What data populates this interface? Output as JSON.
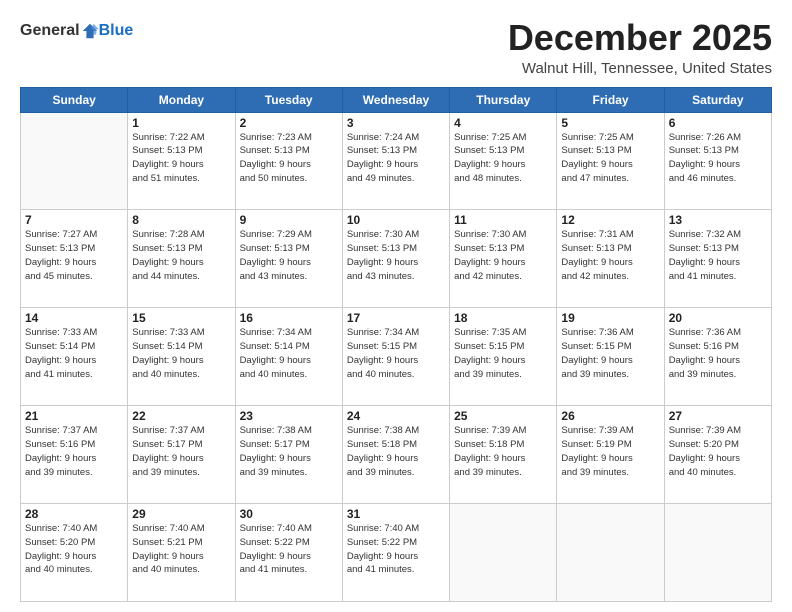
{
  "header": {
    "logo_general": "General",
    "logo_blue": "Blue",
    "title": "December 2025",
    "location": "Walnut Hill, Tennessee, United States"
  },
  "days_of_week": [
    "Sunday",
    "Monday",
    "Tuesday",
    "Wednesday",
    "Thursday",
    "Friday",
    "Saturday"
  ],
  "weeks": [
    [
      {
        "day": "",
        "info": ""
      },
      {
        "day": "1",
        "info": "Sunrise: 7:22 AM\nSunset: 5:13 PM\nDaylight: 9 hours\nand 51 minutes."
      },
      {
        "day": "2",
        "info": "Sunrise: 7:23 AM\nSunset: 5:13 PM\nDaylight: 9 hours\nand 50 minutes."
      },
      {
        "day": "3",
        "info": "Sunrise: 7:24 AM\nSunset: 5:13 PM\nDaylight: 9 hours\nand 49 minutes."
      },
      {
        "day": "4",
        "info": "Sunrise: 7:25 AM\nSunset: 5:13 PM\nDaylight: 9 hours\nand 48 minutes."
      },
      {
        "day": "5",
        "info": "Sunrise: 7:25 AM\nSunset: 5:13 PM\nDaylight: 9 hours\nand 47 minutes."
      },
      {
        "day": "6",
        "info": "Sunrise: 7:26 AM\nSunset: 5:13 PM\nDaylight: 9 hours\nand 46 minutes."
      }
    ],
    [
      {
        "day": "7",
        "info": "Sunrise: 7:27 AM\nSunset: 5:13 PM\nDaylight: 9 hours\nand 45 minutes."
      },
      {
        "day": "8",
        "info": "Sunrise: 7:28 AM\nSunset: 5:13 PM\nDaylight: 9 hours\nand 44 minutes."
      },
      {
        "day": "9",
        "info": "Sunrise: 7:29 AM\nSunset: 5:13 PM\nDaylight: 9 hours\nand 43 minutes."
      },
      {
        "day": "10",
        "info": "Sunrise: 7:30 AM\nSunset: 5:13 PM\nDaylight: 9 hours\nand 43 minutes."
      },
      {
        "day": "11",
        "info": "Sunrise: 7:30 AM\nSunset: 5:13 PM\nDaylight: 9 hours\nand 42 minutes."
      },
      {
        "day": "12",
        "info": "Sunrise: 7:31 AM\nSunset: 5:13 PM\nDaylight: 9 hours\nand 42 minutes."
      },
      {
        "day": "13",
        "info": "Sunrise: 7:32 AM\nSunset: 5:13 PM\nDaylight: 9 hours\nand 41 minutes."
      }
    ],
    [
      {
        "day": "14",
        "info": "Sunrise: 7:33 AM\nSunset: 5:14 PM\nDaylight: 9 hours\nand 41 minutes."
      },
      {
        "day": "15",
        "info": "Sunrise: 7:33 AM\nSunset: 5:14 PM\nDaylight: 9 hours\nand 40 minutes."
      },
      {
        "day": "16",
        "info": "Sunrise: 7:34 AM\nSunset: 5:14 PM\nDaylight: 9 hours\nand 40 minutes."
      },
      {
        "day": "17",
        "info": "Sunrise: 7:34 AM\nSunset: 5:15 PM\nDaylight: 9 hours\nand 40 minutes."
      },
      {
        "day": "18",
        "info": "Sunrise: 7:35 AM\nSunset: 5:15 PM\nDaylight: 9 hours\nand 39 minutes."
      },
      {
        "day": "19",
        "info": "Sunrise: 7:36 AM\nSunset: 5:15 PM\nDaylight: 9 hours\nand 39 minutes."
      },
      {
        "day": "20",
        "info": "Sunrise: 7:36 AM\nSunset: 5:16 PM\nDaylight: 9 hours\nand 39 minutes."
      }
    ],
    [
      {
        "day": "21",
        "info": "Sunrise: 7:37 AM\nSunset: 5:16 PM\nDaylight: 9 hours\nand 39 minutes."
      },
      {
        "day": "22",
        "info": "Sunrise: 7:37 AM\nSunset: 5:17 PM\nDaylight: 9 hours\nand 39 minutes."
      },
      {
        "day": "23",
        "info": "Sunrise: 7:38 AM\nSunset: 5:17 PM\nDaylight: 9 hours\nand 39 minutes."
      },
      {
        "day": "24",
        "info": "Sunrise: 7:38 AM\nSunset: 5:18 PM\nDaylight: 9 hours\nand 39 minutes."
      },
      {
        "day": "25",
        "info": "Sunrise: 7:39 AM\nSunset: 5:18 PM\nDaylight: 9 hours\nand 39 minutes."
      },
      {
        "day": "26",
        "info": "Sunrise: 7:39 AM\nSunset: 5:19 PM\nDaylight: 9 hours\nand 39 minutes."
      },
      {
        "day": "27",
        "info": "Sunrise: 7:39 AM\nSunset: 5:20 PM\nDaylight: 9 hours\nand 40 minutes."
      }
    ],
    [
      {
        "day": "28",
        "info": "Sunrise: 7:40 AM\nSunset: 5:20 PM\nDaylight: 9 hours\nand 40 minutes."
      },
      {
        "day": "29",
        "info": "Sunrise: 7:40 AM\nSunset: 5:21 PM\nDaylight: 9 hours\nand 40 minutes."
      },
      {
        "day": "30",
        "info": "Sunrise: 7:40 AM\nSunset: 5:22 PM\nDaylight: 9 hours\nand 41 minutes."
      },
      {
        "day": "31",
        "info": "Sunrise: 7:40 AM\nSunset: 5:22 PM\nDaylight: 9 hours\nand 41 minutes."
      },
      {
        "day": "",
        "info": ""
      },
      {
        "day": "",
        "info": ""
      },
      {
        "day": "",
        "info": ""
      }
    ]
  ]
}
